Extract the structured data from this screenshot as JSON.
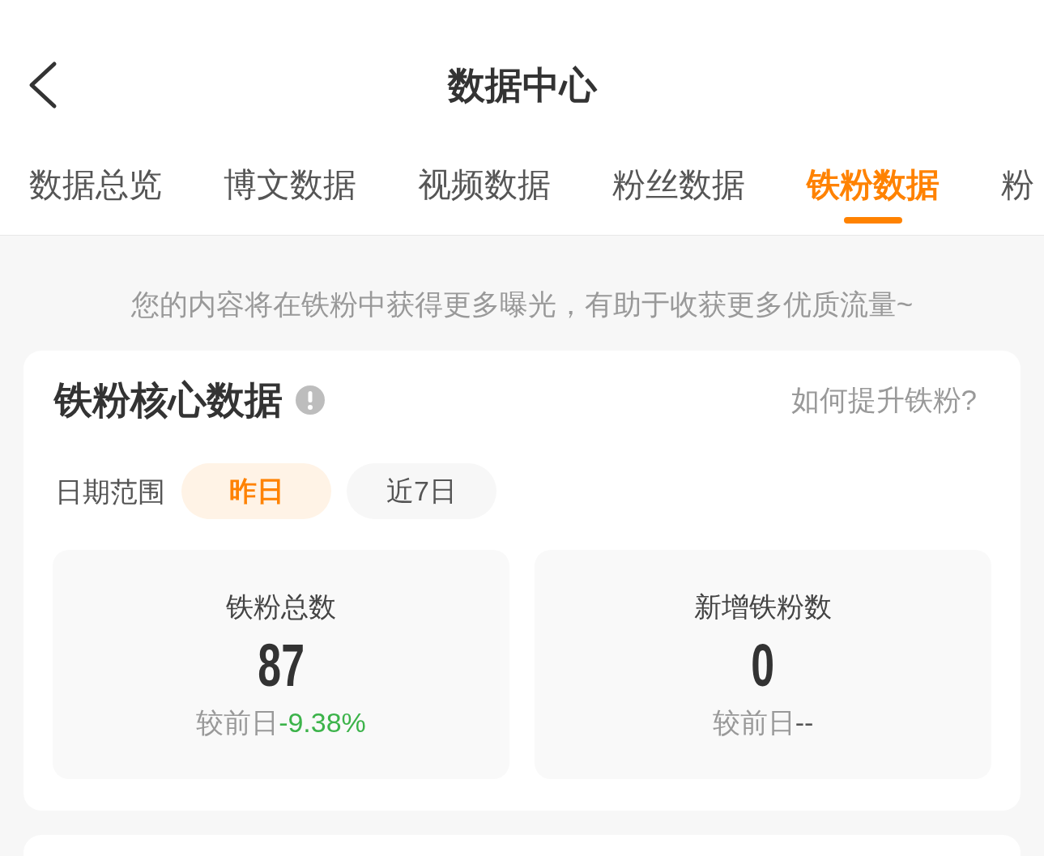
{
  "header": {
    "title": "数据中心"
  },
  "tabs": [
    {
      "label": "数据总览",
      "selected": false
    },
    {
      "label": "博文数据",
      "selected": false
    },
    {
      "label": "视频数据",
      "selected": false
    },
    {
      "label": "粉丝数据",
      "selected": false
    },
    {
      "label": "铁粉数据",
      "selected": true
    },
    {
      "label": "粉",
      "selected": false
    }
  ],
  "hint": "您的内容将在铁粉中获得更多曝光，有助于收获更多优质流量~",
  "core_card": {
    "title": "铁粉核心数据",
    "help_link": "如何提升铁粉?",
    "date_range": {
      "label": "日期范围",
      "options": [
        {
          "label": "昨日",
          "selected": true
        },
        {
          "label": "近7日",
          "selected": false
        }
      ]
    },
    "stats": [
      {
        "label": "铁粉总数",
        "value": "87",
        "compare_label": "较前日",
        "change": "-9.38%",
        "color": "#3cb34a"
      },
      {
        "label": "新增铁粉数",
        "value": "0",
        "compare_label": "较前日",
        "change": "--",
        "color": "#555555"
      }
    ]
  }
}
